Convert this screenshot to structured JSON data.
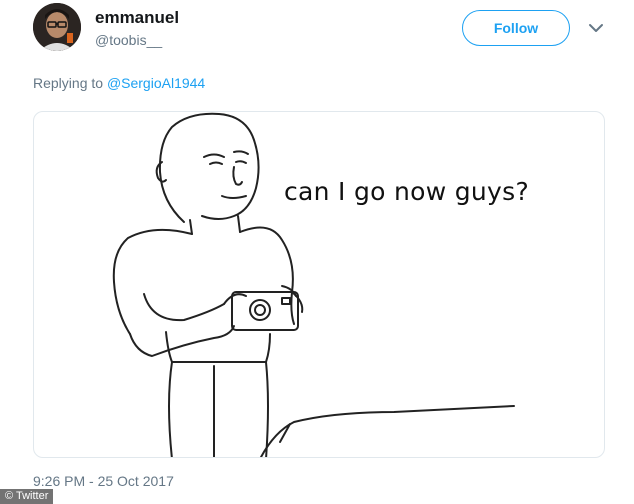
{
  "author": {
    "name": "emmanuel",
    "handle": "@toobis__",
    "avatar_icon": "user-avatar"
  },
  "follow_label": "Follow",
  "menu_icon": "chevron-down-icon",
  "reply": {
    "prefix": "Replying to ",
    "mention": "@SergioAl1944"
  },
  "media": {
    "caption": "can I go now guys?"
  },
  "timestamp": "9:26 PM - 25 Oct 2017",
  "credit": "© Twitter",
  "colors": {
    "accent": "#1da1f2",
    "secondary_text": "#657786",
    "primary_text": "#14171a"
  }
}
